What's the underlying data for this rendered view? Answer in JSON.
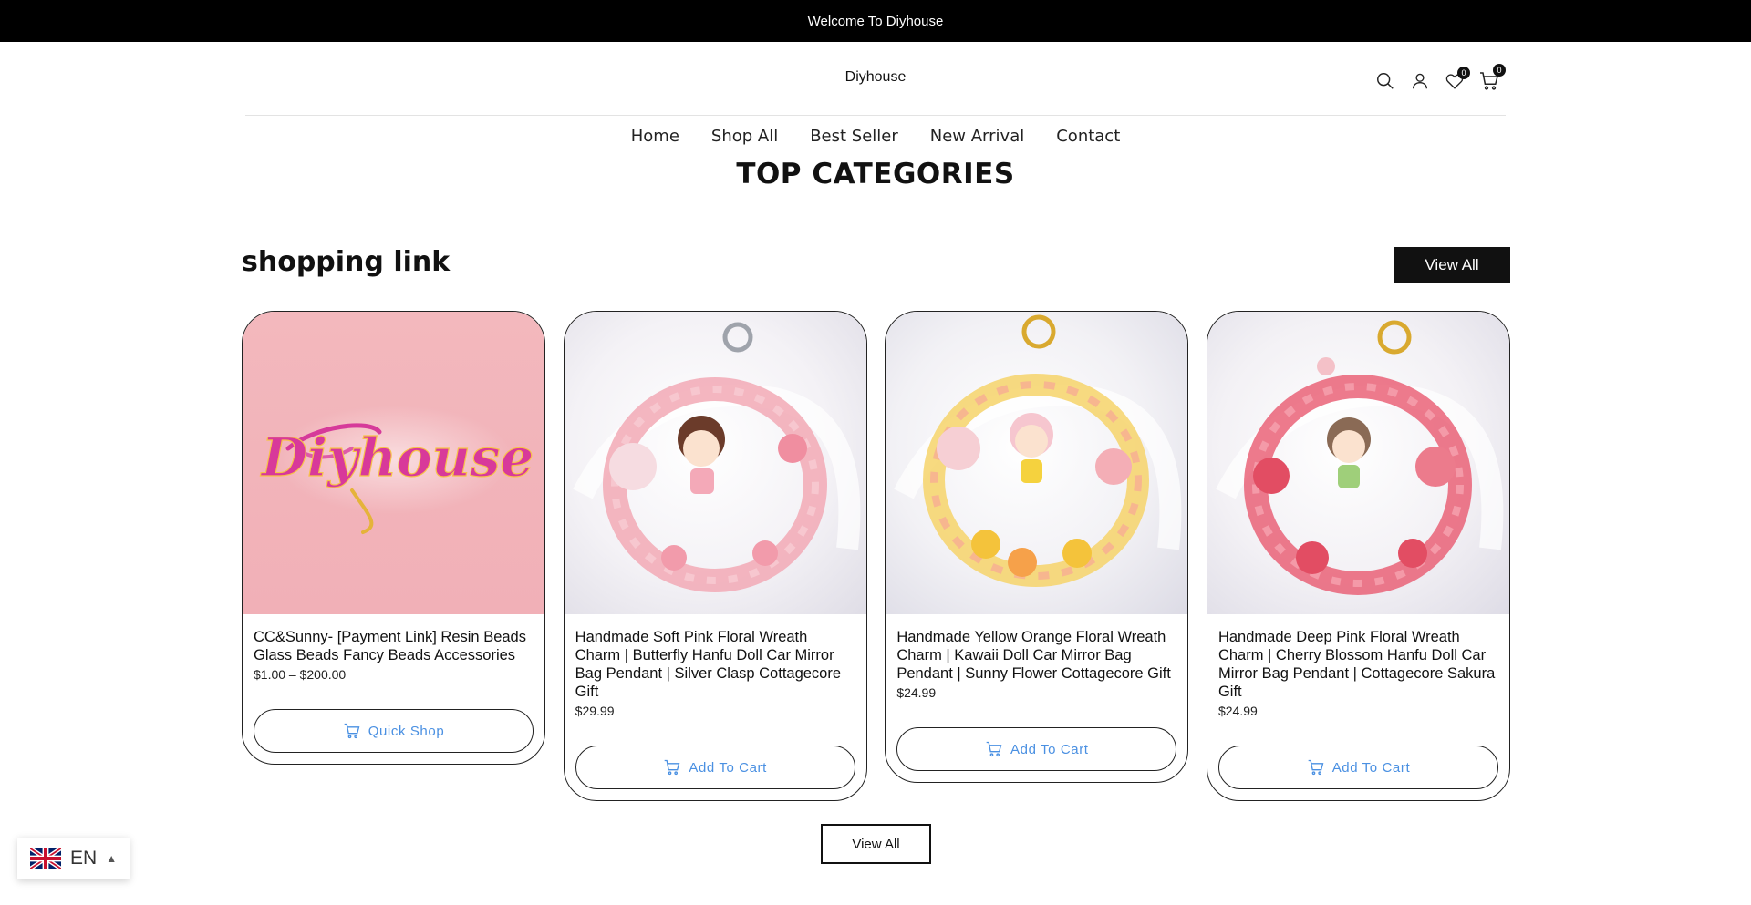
{
  "announcement": {
    "text": "Welcome To Diyhouse"
  },
  "header": {
    "brand": "Diyhouse",
    "wishlist_count": "0",
    "cart_count": "0"
  },
  "nav": {
    "items": [
      "Home",
      "Shop All",
      "Best Seller",
      "New Arrival",
      "Contact"
    ]
  },
  "top_categories": {
    "title": "TOP CATEGORIES"
  },
  "section": {
    "title": "shopping link",
    "view_all_label": "View All"
  },
  "products": [
    {
      "title": "CC&Sunny- [Payment Link] Resin Beads Glass Beads Fancy Beads Accessories",
      "price": "$1.00 – $200.00",
      "button": "Quick Shop",
      "image_text": "Diyhouse"
    },
    {
      "title": "Handmade Soft Pink Floral Wreath Charm | Butterfly Hanfu Doll Car Mirror Bag Pendant | Silver Clasp Cottagecore Gift",
      "price": "$29.99",
      "button": "Add To Cart"
    },
    {
      "title": "Handmade Yellow Orange Floral Wreath Charm | Kawaii Doll Car Mirror Bag Pendant | Sunny Flower Cottagecore Gift",
      "price": "$24.99",
      "button": "Add To Cart"
    },
    {
      "title": "Handmade Deep Pink Floral Wreath Charm | Cherry Blossom Hanfu Doll Car Mirror Bag Pendant | Cottagecore Sakura Gift",
      "price": "$24.99",
      "button": "Add To Cart"
    }
  ],
  "bottom": {
    "view_all_label": "View All"
  },
  "language": {
    "code": "EN"
  },
  "colors": {
    "announcement_bg": "#000000",
    "button_text_blue": "#4a90e2",
    "logo_bg_pink": "#f3b8bd"
  }
}
